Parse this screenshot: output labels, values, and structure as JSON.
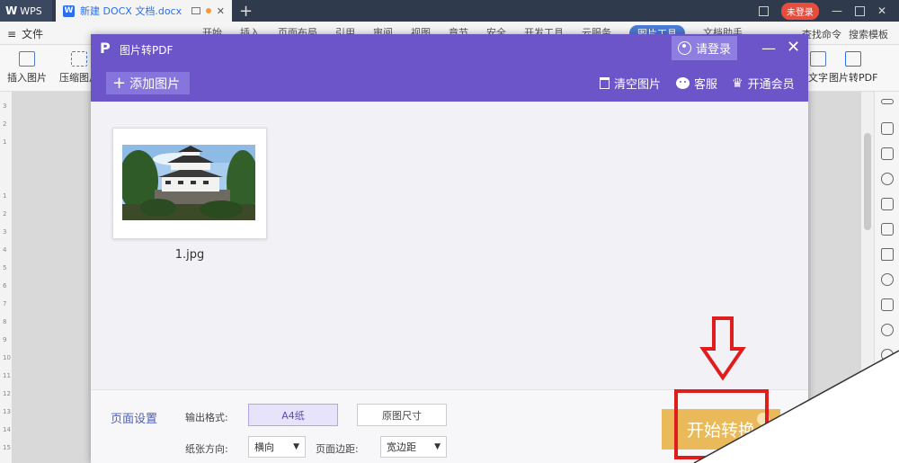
{
  "app": {
    "brand": "WPS",
    "doc_tab": "新建 DOCX 文档.docx",
    "login_badge": "未登录"
  },
  "menu": {
    "file": "文件",
    "tabs": [
      "开始",
      "插入",
      "页面布局",
      "引用",
      "审阅",
      "视图",
      "章节",
      "安全",
      "开发工具",
      "云服务",
      "图片工具",
      "文档助手"
    ],
    "active_tab": "图片工具",
    "search": "查找命令",
    "template": "搜索模板"
  },
  "ribbon": {
    "insert_picture": "插入图片",
    "compress_picture": "压缩图片",
    "text": "文字",
    "pic_to_pdf": "图片转PDF"
  },
  "ruler": [
    "3",
    "2",
    "1",
    "1",
    "2",
    "3",
    "4",
    "5",
    "6",
    "7",
    "8",
    "9",
    "10",
    "11",
    "12",
    "13",
    "14",
    "15"
  ],
  "dialog": {
    "title": "图片转PDF",
    "login": "请登录",
    "add_image": "添加图片",
    "clear_images": "清空图片",
    "support": "客服",
    "vip": "开通会员",
    "file_name": "1.jpg"
  },
  "settings": {
    "title": "页面设置",
    "output_format_label": "输出格式:",
    "format_a4": "A4纸",
    "format_original": "原图尺寸",
    "orientation_label": "纸张方向:",
    "orientation_value": "横向",
    "margin_label": "页面边距:",
    "margin_value": "宽边距",
    "start_button": "开始转换"
  },
  "colors": {
    "dialog_header": "#6b55c9",
    "start_button": "#e9b95a",
    "annotation_red": "#e01d1d"
  }
}
